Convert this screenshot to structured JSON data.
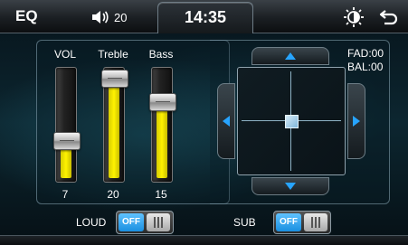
{
  "header": {
    "title": "EQ",
    "volume": "20",
    "time": "14:35"
  },
  "faders": [
    {
      "label": "VOL",
      "value": "7",
      "level": 0.36
    },
    {
      "label": "Treble",
      "value": "20",
      "level": 0.94
    },
    {
      "label": "Bass",
      "value": "15",
      "level": 0.72
    }
  ],
  "balance": {
    "fad": "FAD:00",
    "bal": "BAL:00"
  },
  "toggles": {
    "loud": {
      "label": "LOUD",
      "state": "OFF"
    },
    "sub": {
      "label": "SUB",
      "state": "OFF"
    }
  },
  "colors": {
    "accent": "#27a4ff",
    "fader_fill": "#fff200"
  }
}
